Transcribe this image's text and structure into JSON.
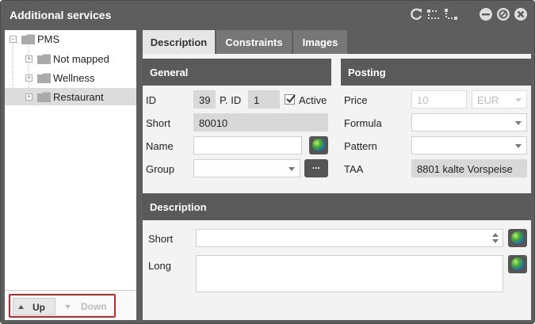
{
  "window": {
    "title": "Additional services"
  },
  "titlebar_icons": [
    "refresh-icon",
    "tree-view-icon",
    "hierarchy-icon",
    "minimize-icon",
    "block-icon",
    "close-icon"
  ],
  "tree": {
    "root": "PMS",
    "items": [
      {
        "label": "Not mapped"
      },
      {
        "label": "Wellness"
      },
      {
        "label": "Restaurant",
        "selected": true
      }
    ],
    "up_label": "Up",
    "down_label": "Down"
  },
  "tabs": [
    {
      "label": "Description",
      "active": true
    },
    {
      "label": "Constraints"
    },
    {
      "label": "Images"
    }
  ],
  "general": {
    "heading": "General",
    "id_label": "ID",
    "id_value": "39",
    "pid_label": "P. ID",
    "pid_value": "1",
    "active_label": "Active",
    "active_checked": true,
    "short_label": "Short",
    "short_value": "80010",
    "name_label": "Name",
    "name_value": "",
    "group_label": "Group",
    "group_value": "",
    "group_btn": "..."
  },
  "posting": {
    "heading": "Posting",
    "price_label": "Price",
    "price_value": "10",
    "currency": "EUR",
    "formula_label": "Formula",
    "formula_value": "",
    "pattern_label": "Pattern",
    "pattern_value": "",
    "taa_label": "TAA",
    "taa_value": "8801 kalte Vorspeise"
  },
  "description": {
    "heading": "Description",
    "short_label": "Short",
    "short_value": "",
    "long_label": "Long",
    "long_value": ""
  },
  "colors": {
    "titlebar": "#5e5e5e",
    "section_head": "#5a5a5a",
    "highlight_border": "#c0282d"
  }
}
